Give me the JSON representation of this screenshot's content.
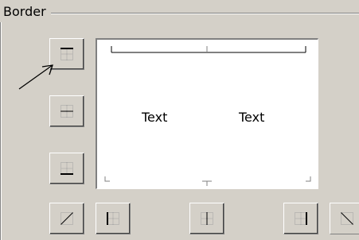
{
  "dialog": {
    "group_title": "Border"
  },
  "preview": {
    "cell_text_left": "Text",
    "cell_text_right": "Text"
  },
  "buttons": [
    {
      "name": "border-top-button",
      "icon": "border-top-icon"
    },
    {
      "name": "border-inside-horizontal-button",
      "icon": "border-inside-horizontal-icon"
    },
    {
      "name": "border-bottom-button",
      "icon": "border-bottom-icon"
    },
    {
      "name": "border-diagonal-up-button",
      "icon": "border-diagonal-up-icon"
    },
    {
      "name": "border-left-button",
      "icon": "border-left-icon"
    },
    {
      "name": "border-inside-vertical-button",
      "icon": "border-inside-vertical-icon"
    },
    {
      "name": "border-right-button",
      "icon": "border-right-icon"
    },
    {
      "name": "border-diagonal-down-button",
      "icon": "border-diagonal-down-icon"
    }
  ],
  "colors": {
    "face": "#d4d0c8",
    "shadow": "#808080",
    "highlight": "#ffffff",
    "preview_background": "#ffffff"
  }
}
